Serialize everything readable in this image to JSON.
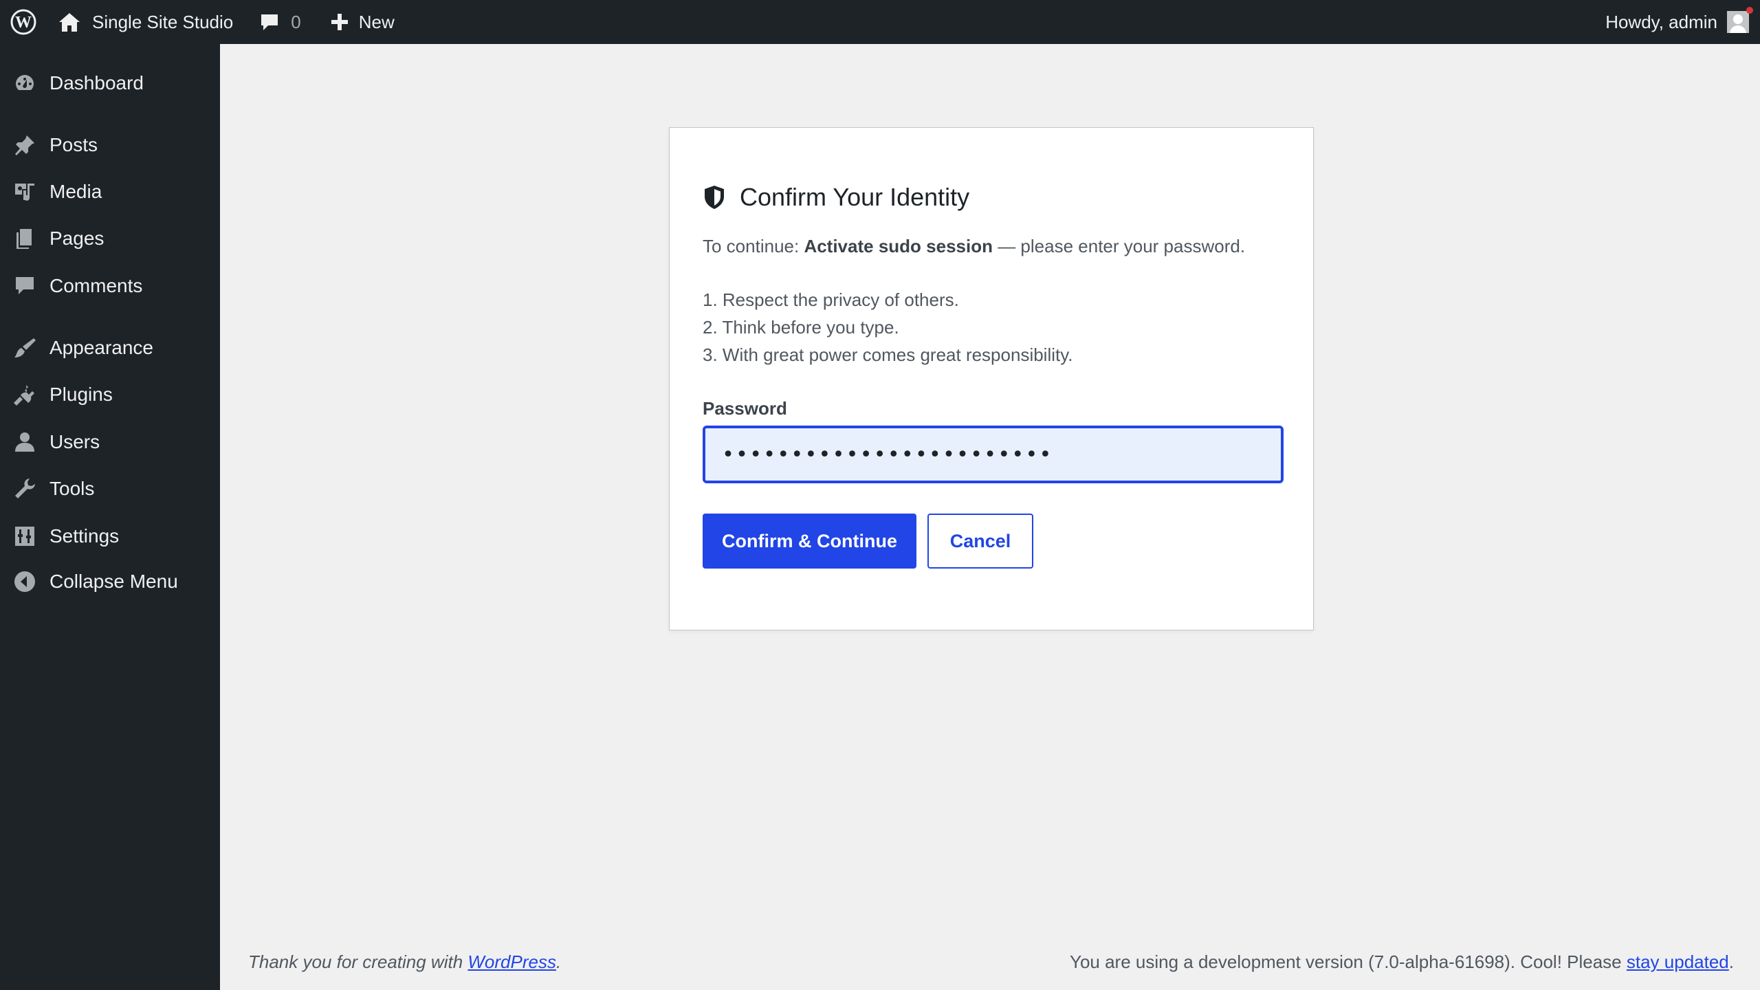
{
  "admin_bar": {
    "site_name": "Single Site Studio",
    "comment_count": "0",
    "new_label": "New",
    "greeting": "Howdy, admin"
  },
  "sidebar": {
    "items": [
      {
        "label": "Dashboard",
        "icon": "dashboard-icon"
      },
      {
        "label": "Posts",
        "icon": "pin-icon"
      },
      {
        "label": "Media",
        "icon": "media-icon"
      },
      {
        "label": "Pages",
        "icon": "pages-icon"
      },
      {
        "label": "Comments",
        "icon": "comment-icon"
      },
      {
        "label": "Appearance",
        "icon": "paintbrush-icon"
      },
      {
        "label": "Plugins",
        "icon": "plugin-icon"
      },
      {
        "label": "Users",
        "icon": "user-icon"
      },
      {
        "label": "Tools",
        "icon": "wrench-icon"
      },
      {
        "label": "Settings",
        "icon": "settings-icon"
      },
      {
        "label": "Collapse Menu",
        "icon": "collapse-icon"
      }
    ]
  },
  "dialog": {
    "title": "Confirm Your Identity",
    "desc_prefix": "To continue: ",
    "desc_action": "Activate sudo session",
    "desc_suffix": " — please enter your password.",
    "list": [
      "1. Respect the privacy of others.",
      "2. Think before you type.",
      "3. With great power comes great responsibility."
    ],
    "password_label": "Password",
    "password_value": "••••••••••••••••••••••••",
    "confirm_label": "Confirm & Continue",
    "cancel_label": "Cancel"
  },
  "footer": {
    "left_prefix": "Thank you for creating with ",
    "left_link": "WordPress",
    "left_suffix": ".",
    "right_prefix": "You are using a development version (7.0-alpha-61698). Cool! Please ",
    "right_link": "stay updated",
    "right_suffix": "."
  },
  "colors": {
    "accent": "#2145e6",
    "admin_bg": "#1d2327",
    "page_bg": "#f0f0f1"
  }
}
